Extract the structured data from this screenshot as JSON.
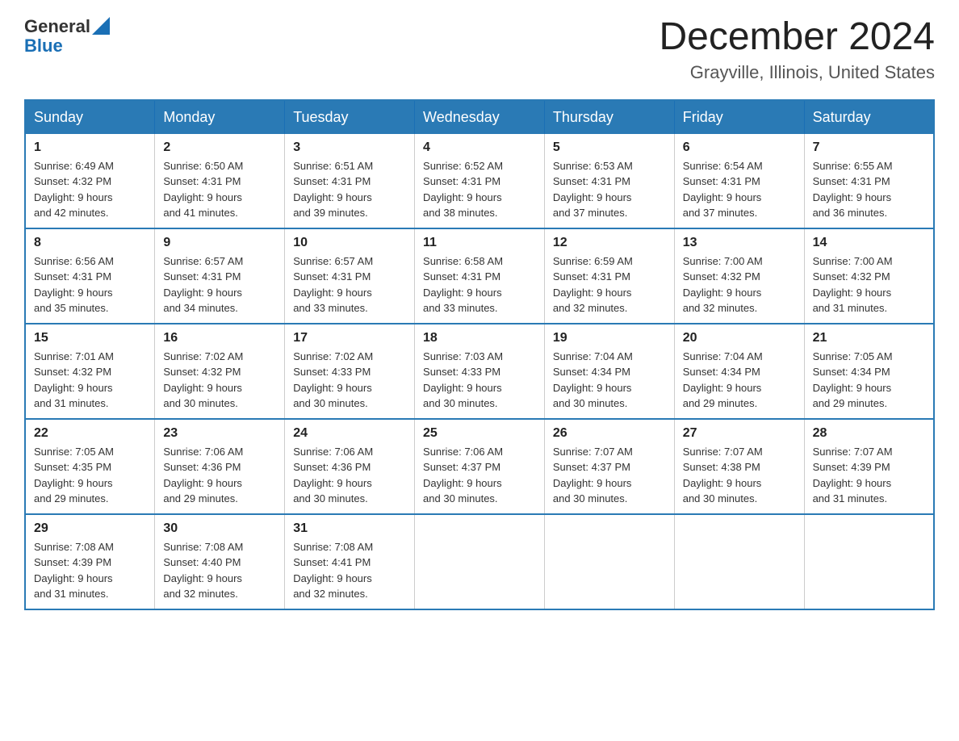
{
  "logo": {
    "general": "General",
    "blue": "Blue"
  },
  "title": "December 2024",
  "location": "Grayville, Illinois, United States",
  "days_of_week": [
    "Sunday",
    "Monday",
    "Tuesday",
    "Wednesday",
    "Thursday",
    "Friday",
    "Saturday"
  ],
  "weeks": [
    [
      {
        "day": "1",
        "sunrise": "6:49 AM",
        "sunset": "4:32 PM",
        "daylight": "9 hours and 42 minutes."
      },
      {
        "day": "2",
        "sunrise": "6:50 AM",
        "sunset": "4:31 PM",
        "daylight": "9 hours and 41 minutes."
      },
      {
        "day": "3",
        "sunrise": "6:51 AM",
        "sunset": "4:31 PM",
        "daylight": "9 hours and 39 minutes."
      },
      {
        "day": "4",
        "sunrise": "6:52 AM",
        "sunset": "4:31 PM",
        "daylight": "9 hours and 38 minutes."
      },
      {
        "day": "5",
        "sunrise": "6:53 AM",
        "sunset": "4:31 PM",
        "daylight": "9 hours and 37 minutes."
      },
      {
        "day": "6",
        "sunrise": "6:54 AM",
        "sunset": "4:31 PM",
        "daylight": "9 hours and 37 minutes."
      },
      {
        "day": "7",
        "sunrise": "6:55 AM",
        "sunset": "4:31 PM",
        "daylight": "9 hours and 36 minutes."
      }
    ],
    [
      {
        "day": "8",
        "sunrise": "6:56 AM",
        "sunset": "4:31 PM",
        "daylight": "9 hours and 35 minutes."
      },
      {
        "day": "9",
        "sunrise": "6:57 AM",
        "sunset": "4:31 PM",
        "daylight": "9 hours and 34 minutes."
      },
      {
        "day": "10",
        "sunrise": "6:57 AM",
        "sunset": "4:31 PM",
        "daylight": "9 hours and 33 minutes."
      },
      {
        "day": "11",
        "sunrise": "6:58 AM",
        "sunset": "4:31 PM",
        "daylight": "9 hours and 33 minutes."
      },
      {
        "day": "12",
        "sunrise": "6:59 AM",
        "sunset": "4:31 PM",
        "daylight": "9 hours and 32 minutes."
      },
      {
        "day": "13",
        "sunrise": "7:00 AM",
        "sunset": "4:32 PM",
        "daylight": "9 hours and 32 minutes."
      },
      {
        "day": "14",
        "sunrise": "7:00 AM",
        "sunset": "4:32 PM",
        "daylight": "9 hours and 31 minutes."
      }
    ],
    [
      {
        "day": "15",
        "sunrise": "7:01 AM",
        "sunset": "4:32 PM",
        "daylight": "9 hours and 31 minutes."
      },
      {
        "day": "16",
        "sunrise": "7:02 AM",
        "sunset": "4:32 PM",
        "daylight": "9 hours and 30 minutes."
      },
      {
        "day": "17",
        "sunrise": "7:02 AM",
        "sunset": "4:33 PM",
        "daylight": "9 hours and 30 minutes."
      },
      {
        "day": "18",
        "sunrise": "7:03 AM",
        "sunset": "4:33 PM",
        "daylight": "9 hours and 30 minutes."
      },
      {
        "day": "19",
        "sunrise": "7:04 AM",
        "sunset": "4:34 PM",
        "daylight": "9 hours and 30 minutes."
      },
      {
        "day": "20",
        "sunrise": "7:04 AM",
        "sunset": "4:34 PM",
        "daylight": "9 hours and 29 minutes."
      },
      {
        "day": "21",
        "sunrise": "7:05 AM",
        "sunset": "4:34 PM",
        "daylight": "9 hours and 29 minutes."
      }
    ],
    [
      {
        "day": "22",
        "sunrise": "7:05 AM",
        "sunset": "4:35 PM",
        "daylight": "9 hours and 29 minutes."
      },
      {
        "day": "23",
        "sunrise": "7:06 AM",
        "sunset": "4:36 PM",
        "daylight": "9 hours and 29 minutes."
      },
      {
        "day": "24",
        "sunrise": "7:06 AM",
        "sunset": "4:36 PM",
        "daylight": "9 hours and 30 minutes."
      },
      {
        "day": "25",
        "sunrise": "7:06 AM",
        "sunset": "4:37 PM",
        "daylight": "9 hours and 30 minutes."
      },
      {
        "day": "26",
        "sunrise": "7:07 AM",
        "sunset": "4:37 PM",
        "daylight": "9 hours and 30 minutes."
      },
      {
        "day": "27",
        "sunrise": "7:07 AM",
        "sunset": "4:38 PM",
        "daylight": "9 hours and 30 minutes."
      },
      {
        "day": "28",
        "sunrise": "7:07 AM",
        "sunset": "4:39 PM",
        "daylight": "9 hours and 31 minutes."
      }
    ],
    [
      {
        "day": "29",
        "sunrise": "7:08 AM",
        "sunset": "4:39 PM",
        "daylight": "9 hours and 31 minutes."
      },
      {
        "day": "30",
        "sunrise": "7:08 AM",
        "sunset": "4:40 PM",
        "daylight": "9 hours and 32 minutes."
      },
      {
        "day": "31",
        "sunrise": "7:08 AM",
        "sunset": "4:41 PM",
        "daylight": "9 hours and 32 minutes."
      },
      null,
      null,
      null,
      null
    ]
  ],
  "labels": {
    "sunrise": "Sunrise:",
    "sunset": "Sunset:",
    "daylight": "Daylight:"
  }
}
